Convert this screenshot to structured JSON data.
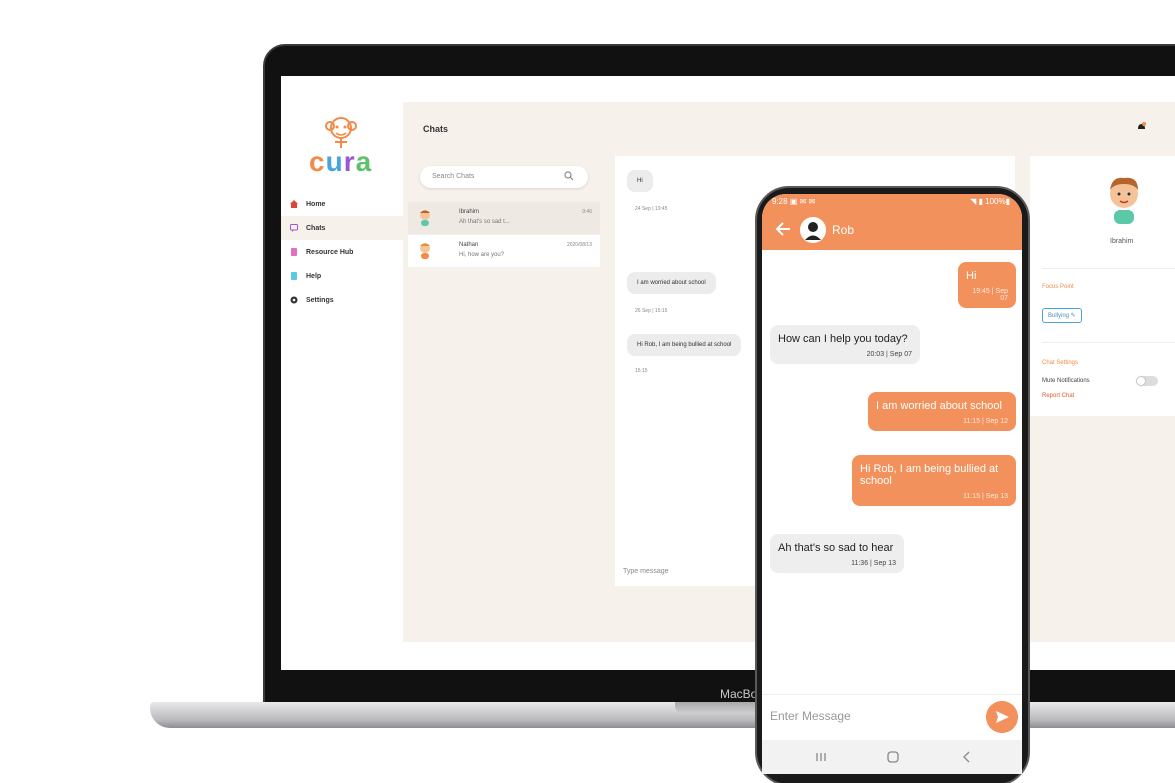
{
  "laptop": {
    "brand": "MacBo"
  },
  "app": {
    "logo": [
      "c",
      "u",
      "r",
      "a"
    ],
    "nav": [
      {
        "label": "Home",
        "color": "#e0453a"
      },
      {
        "label": "Chats",
        "color": "#9b59d0"
      },
      {
        "label": "Resource Hub",
        "color": "#e36fc0"
      },
      {
        "label": "Help",
        "color": "#5bc8e8"
      },
      {
        "label": "Settings",
        "color": "#333333"
      }
    ],
    "page_title": "Chats",
    "search_placeholder": "Search Chats",
    "chats": [
      {
        "name": "Ibrahim",
        "preview": "Ah that's so sad t...",
        "time": "9:46"
      },
      {
        "name": "Nathan",
        "preview": "Hi, how are you?",
        "time": "2020/08/13"
      }
    ],
    "conversation": {
      "messages": [
        {
          "text": "Hi",
          "time": "24 Sep | 19:45"
        },
        {
          "text": "I am worried about school",
          "time": "26 Sep | 15:15"
        },
        {
          "text": "Hi Rob, I am being bullied at school",
          "time": "15:15"
        }
      ],
      "input_placeholder": "Type message"
    },
    "profile": {
      "name": "Ibrahim",
      "focus_label": "Focus Point",
      "focus_value": "Bullying ✎",
      "chat_settings_label": "Chat Settings",
      "mute_label": "Mute Notifications",
      "report_label": "Report Chat"
    }
  },
  "phone": {
    "status_left": "9:28 ▣ ✉ ✉",
    "status_right": "◥ ▮ 100%▮",
    "contact": "Rob",
    "messages": [
      {
        "dir": "sent",
        "text": "Hi",
        "time": "19:45 | Sep 07"
      },
      {
        "dir": "recv",
        "text": "How can I help you today?",
        "time": "20:03 | Sep 07"
      },
      {
        "dir": "sent",
        "text": "I am worried about school",
        "time": "11:15 | Sep 12"
      },
      {
        "dir": "sent",
        "text": "Hi Rob, I am being bullied at school",
        "time": "11:15 | Sep 13"
      },
      {
        "dir": "recv",
        "text": "Ah that's so sad to hear",
        "time": "11:36 | Sep 13"
      }
    ],
    "input_placeholder": "Enter Message",
    "accent": "#f3915d"
  }
}
